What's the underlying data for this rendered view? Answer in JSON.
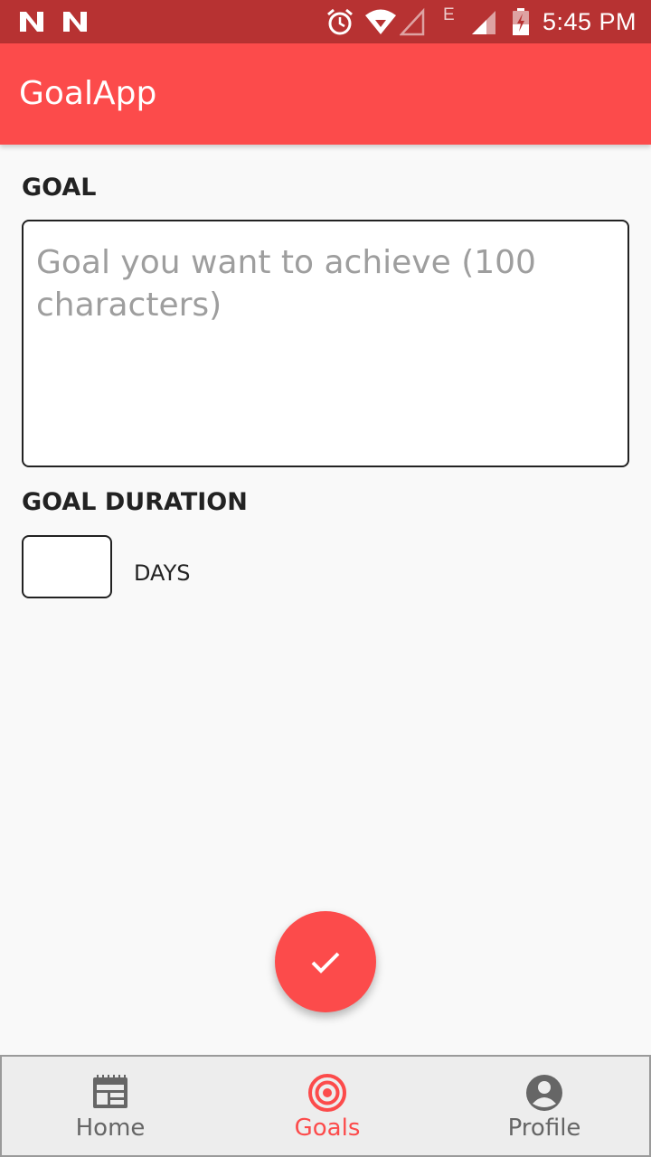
{
  "status_bar": {
    "network_type": "E",
    "time": "5:45 PM",
    "icons": [
      "n-notification-icon",
      "n-notification-icon",
      "alarm-icon",
      "wifi-icon",
      "signal-icon",
      "signal-icon",
      "battery-charging-icon"
    ]
  },
  "app_bar": {
    "title": "GoalApp"
  },
  "form": {
    "goal_label": "GOAL",
    "goal_placeholder": "Goal you want to achieve (100 characters)",
    "goal_value": "",
    "duration_label": "GOAL DURATION",
    "days_value": "",
    "days_unit": "DAYS"
  },
  "fab": {
    "icon": "check-icon"
  },
  "bottom_nav": {
    "items": [
      {
        "label": "Home",
        "icon": "home-calendar-icon",
        "active": false
      },
      {
        "label": "Goals",
        "icon": "target-icon",
        "active": true
      },
      {
        "label": "Profile",
        "icon": "profile-icon",
        "active": false
      }
    ]
  },
  "colors": {
    "status_bar": "#b73232",
    "accent": "#fc4b4b",
    "nav_inactive": "#666666"
  }
}
